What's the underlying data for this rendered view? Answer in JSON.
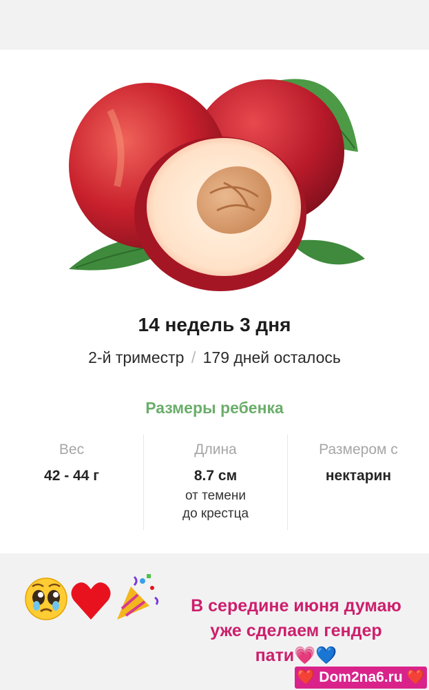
{
  "app": {
    "week_title": "14 недель 3 дня",
    "trimester": "2-й триместр",
    "days_left": "179 дней осталось",
    "section_title": "Размеры ребенка",
    "stats": [
      {
        "label": "Вес",
        "value": "42 - 44 г"
      },
      {
        "label": "Длина",
        "value": "8.7 см",
        "note_line1": "от темени",
        "note_line2": "до крестца"
      },
      {
        "label": "Размером с",
        "value": "нектарин"
      }
    ]
  },
  "story": {
    "emoji_icons": [
      "pleading-face-icon",
      "red-heart-icon",
      "party-popper-icon"
    ],
    "caption_line1": "В середине июня думаю",
    "caption_line2": "уже сделаем гендер",
    "caption_line3": "пати💗💙",
    "watermark": "❤️ Dom2na6.ru ❤️"
  },
  "colors": {
    "accent_green": "#6aad6a",
    "caption_pink": "#cc1f6c",
    "watermark_bg": "#d9238a"
  }
}
